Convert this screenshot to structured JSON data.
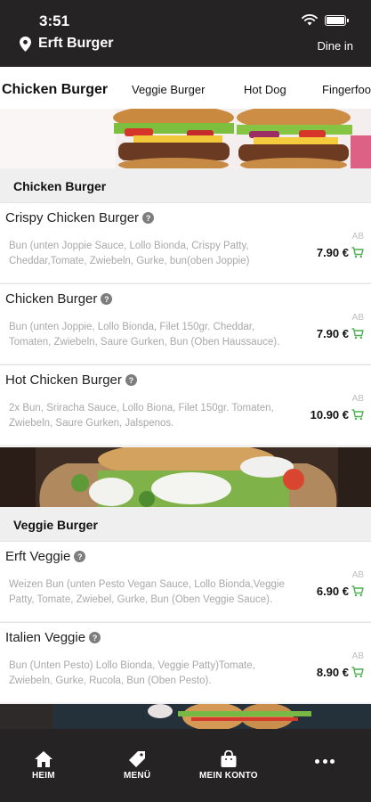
{
  "status_bar": {
    "time": "3:51"
  },
  "header": {
    "store_name": "Erft Burger",
    "order_mode": "Dine in"
  },
  "tabs": [
    {
      "label": "Chicken Burger"
    },
    {
      "label": "Veggie Burger"
    },
    {
      "label": "Hot Dog"
    },
    {
      "label": "Fingerfood"
    }
  ],
  "sections": [
    {
      "title": "Chicken Burger",
      "items": [
        {
          "name": "Crispy Chicken Burger",
          "description": "Bun (unten Joppie Sauce, Lollo Bionda, Crispy Patty, Cheddar,Tomate, Zwiebeln, Gurke, bun(oben Joppie)",
          "price_prefix": "AB",
          "price": "7.90 €"
        },
        {
          "name": "Chicken Burger",
          "description": "Bun (unten Joppie, Lollo Bionda, Filet 150gr. Cheddar, Tomaten, Zwiebeln, Saure Gurken, Bun (Oben Haussauce).",
          "price_prefix": "AB",
          "price": "7.90 €"
        },
        {
          "name": "Hot Chicken Burger",
          "description": "2x Bun, Sriracha Sauce, Lollo Biona, Filet 150gr. Tomaten, Zwiebeln, Saure Gurken, Jalspenos.",
          "price_prefix": "AB",
          "price": "10.90 €"
        }
      ]
    },
    {
      "title": "Veggie Burger",
      "items": [
        {
          "name": "Erft Veggie",
          "description": "Weizen Bun (unten Pesto Vegan Sauce, Lollo Bionda,Veggie Patty, Tomate, Zwiebel, Gurke, Bun (Oben Veggie Sauce).",
          "price_prefix": "AB",
          "price": "6.90 €"
        },
        {
          "name": "Italien Veggie",
          "description": "Bun (Unten Pesto) Lollo Bionda, Veggie Patty)Tomate, Zwiebeln, Gurke, Rucola, Bun (Oben Pesto).",
          "price_prefix": "AB",
          "price": "8.90 €"
        }
      ]
    }
  ],
  "bottom_nav": [
    {
      "label": "HEIM",
      "icon": "home-icon"
    },
    {
      "label": "MENÜ",
      "icon": "tag-icon"
    },
    {
      "label": "MEIN KONTO",
      "icon": "bag-icon"
    },
    {
      "label": "",
      "icon": "more-icon"
    }
  ],
  "colors": {
    "header_bg": "#262324",
    "cart_icon": "#4caf50",
    "section_bg": "#efefef"
  }
}
